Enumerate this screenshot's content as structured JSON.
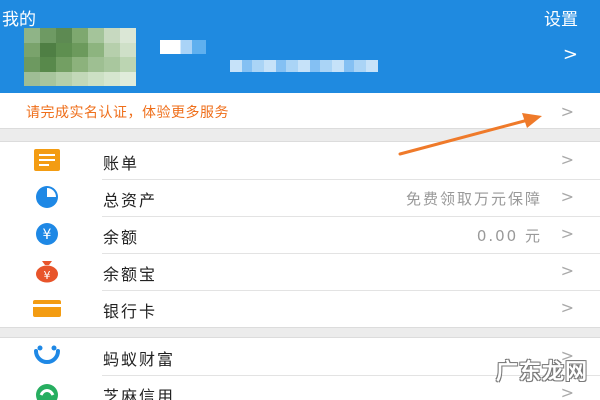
{
  "header": {
    "title": "我的",
    "settings_label": "设置",
    "chevron": ">"
  },
  "verify_banner": {
    "text": "请完成实名认证，体验更多服务",
    "chevron": ">"
  },
  "menu_group_1": [
    {
      "label": "账单",
      "value": "",
      "icon": "bill-icon"
    },
    {
      "label": "总资产",
      "value": "免费领取万元保障",
      "icon": "pie-chart-icon"
    },
    {
      "label": "余额",
      "value": "0.00 元",
      "icon": "yuan-coin-icon"
    },
    {
      "label": "余额宝",
      "value": "",
      "icon": "money-bag-icon"
    },
    {
      "label": "银行卡",
      "value": "",
      "icon": "bank-card-icon"
    }
  ],
  "menu_group_2": [
    {
      "label": "蚂蚁财富",
      "value": "",
      "icon": "ant-fortune-icon"
    },
    {
      "label": "芝麻信用",
      "value": "",
      "icon": "sesame-credit-icon"
    }
  ],
  "chevron": ">",
  "watermark": "广东龙网",
  "colors": {
    "header_bg": "#1f8ae0",
    "accent_orange": "#ef6f1b",
    "icon_blue": "#1e88e5",
    "icon_orange": "#f39c12",
    "icon_red_orange": "#e8542a"
  }
}
